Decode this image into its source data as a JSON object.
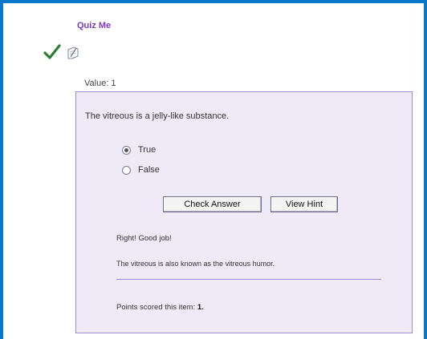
{
  "quiz": {
    "title": "Quiz Me",
    "value_label": "Value: 1",
    "question": "The vitreous is a jelly-like substance.",
    "options": [
      {
        "label": "True",
        "selected": true
      },
      {
        "label": "False",
        "selected": false
      }
    ],
    "buttons": {
      "check_answer": "Check Answer",
      "view_hint": "View Hint"
    },
    "feedback": "Right! Good job!",
    "explanation": "The vitreous is also known as the vitreous humor.",
    "points_label": "Points scored this item:",
    "points_value": "1."
  },
  "icons": {
    "status": "checkmark-icon",
    "note": "note-icon"
  },
  "colors": {
    "frame": "#0a78c8",
    "title": "#7a3cc8",
    "panel_bg": "#efeaf8",
    "panel_border": "#9b8fd0",
    "check": "#2e7d32"
  }
}
